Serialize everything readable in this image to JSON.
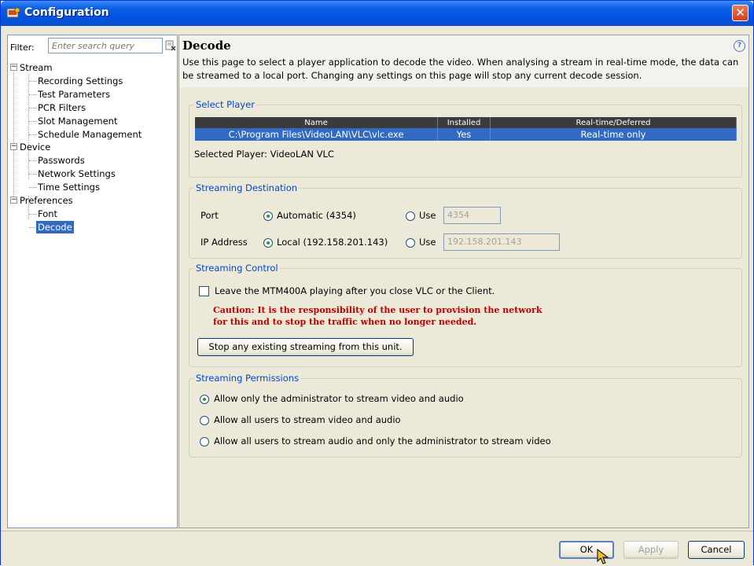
{
  "window": {
    "title": "Configuration",
    "close_glyph": "✕"
  },
  "filter": {
    "label": "Filter:",
    "placeholder": "Enter search query"
  },
  "tree": {
    "stream": "Stream",
    "recording_settings": "Recording Settings",
    "test_parameters": "Test Parameters",
    "pcr_filters": "PCR Filters",
    "slot_management": "Slot Management",
    "schedule_management": "Schedule Management",
    "device": "Device",
    "passwords": "Passwords",
    "network_settings": "Network Settings",
    "time_settings": "Time Settings",
    "preferences": "Preferences",
    "font": "Font",
    "decode": "Decode"
  },
  "page": {
    "heading": "Decode",
    "description": "Use this page to select a player application to decode the video. When analysing a stream in real-time mode, the data can be streamed to a local port. Changing any settings on this page will stop any current decode session."
  },
  "select_player": {
    "title": "Select Player",
    "columns": [
      "Name",
      "Installed",
      "Real-time/Deferred"
    ],
    "rows": [
      [
        "C:\\Program Files\\VideoLAN\\VLC\\vlc.exe",
        "Yes",
        "Real-time only"
      ]
    ],
    "selected_text": "Selected Player: VideoLAN VLC"
  },
  "streaming_destination": {
    "title": "Streaming Destination",
    "port_label": "Port",
    "port_auto": "Automatic (4354)",
    "use_label": "Use",
    "port_value": "4354",
    "ip_label": "IP Address",
    "ip_local": "Local (192.158.201.143)",
    "ip_value": "192.158.201.143"
  },
  "streaming_control": {
    "title": "Streaming Control",
    "checkbox_label": "Leave the MTM400A playing after you close VLC or the Client.",
    "caution_line1": "Caution: It is the responsibility of the user to provision the network",
    "caution_line2": "for this and to stop the traffic when no longer needed.",
    "stop_button": "Stop any existing streaming from this unit."
  },
  "streaming_permissions": {
    "title": "Streaming Permissions",
    "option1": "Allow only the administrator to stream video and audio",
    "option2": "Allow all users to stream video and audio",
    "option3": "Allow all users to stream audio and only the administrator to stream video"
  },
  "buttons": {
    "ok": "OK",
    "apply": "Apply",
    "cancel": "Cancel"
  }
}
